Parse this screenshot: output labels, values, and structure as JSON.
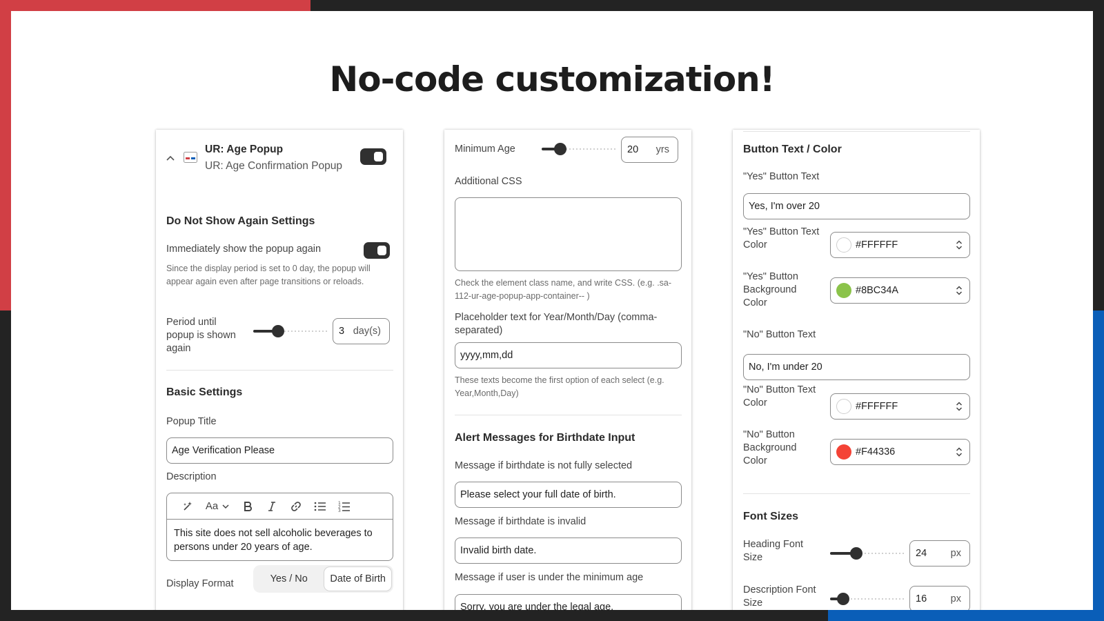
{
  "headline": "No-code customization!",
  "colors": {
    "red_corner": "#d13f45",
    "blue_corner": "#0a5eb8",
    "frame": "#232323",
    "toggle_on": "#303030"
  },
  "left_panel": {
    "app_name": "UR: Age Popup",
    "app_subtitle": "UR: Age Confirmation Popup",
    "app_enabled": true,
    "do_not_show": {
      "title": "Do Not Show Again Settings",
      "immediate_label": "Immediately show the popup again",
      "immediate_enabled": true,
      "immediate_help": "Since the display period is set to 0 day, the popup will appear again even after page transitions or reloads.",
      "period_label": "Period until popup is shown again",
      "period_value": "3",
      "period_unit": "day(s)",
      "period_fraction": 0.33
    },
    "basic": {
      "title": "Basic Settings",
      "popup_title_label": "Popup Title",
      "popup_title_value": "Age Verification Please",
      "description_label": "Description",
      "description_text": "This site does not sell alcoholic beverages to persons under 20 years of age.",
      "toolbar_font_label": "Aa",
      "display_format_label": "Display Format",
      "display_format_options": [
        "Yes / No",
        "Date of Birth"
      ],
      "display_format_selected": "Date of Birth"
    }
  },
  "middle_panel": {
    "min_age_label": "Minimum Age",
    "min_age_value": "20",
    "min_age_unit": "yrs",
    "min_age_fraction": 0.25,
    "css_label": "Additional CSS",
    "css_help": "Check the element class name, and write CSS. (e.g. .sa-112-ur-age-popup-app-container-- )",
    "placeholder_label": "Placeholder text for Year/Month/Day (comma-separated)",
    "placeholder_value": "yyyy,mm,dd",
    "placeholder_help": "These texts become the first option of each select (e.g. Year,Month,Day)",
    "alerts": {
      "title": "Alert Messages for Birthdate Input",
      "not_selected_label": "Message if birthdate is not fully selected",
      "not_selected_value": "Please select your full date of birth.",
      "invalid_label": "Message if birthdate is invalid",
      "invalid_value": "Invalid birth date.",
      "under_age_label": "Message if user is under the minimum age",
      "under_age_value": "Sorry, you are under the legal age."
    }
  },
  "right_panel": {
    "button_title": "Button Text / Color",
    "yes_text_label": "\"Yes\" Button Text",
    "yes_text_value": "Yes, I'm over 20",
    "yes_text_color_label": "\"Yes\" Button Text Color",
    "yes_text_color_value": "#FFFFFF",
    "yes_bg_label": "\"Yes\" Button Background Color",
    "yes_bg_value": "#8BC34A",
    "no_text_label": "\"No\" Button Text",
    "no_text_value": "No, I'm under 20",
    "no_text_color_label": "\"No\" Button Text Color",
    "no_text_color_value": "#FFFFFF",
    "no_bg_label": "\"No\" Button Background Color",
    "no_bg_value": "#F44336",
    "font_title": "Font Sizes",
    "heading_size_label": "Heading Font Size",
    "heading_size_value": "24",
    "heading_size_fraction": 0.35,
    "description_size_label": "Description Font Size",
    "description_size_value": "16",
    "description_size_fraction": 0.18,
    "unit": "px"
  }
}
